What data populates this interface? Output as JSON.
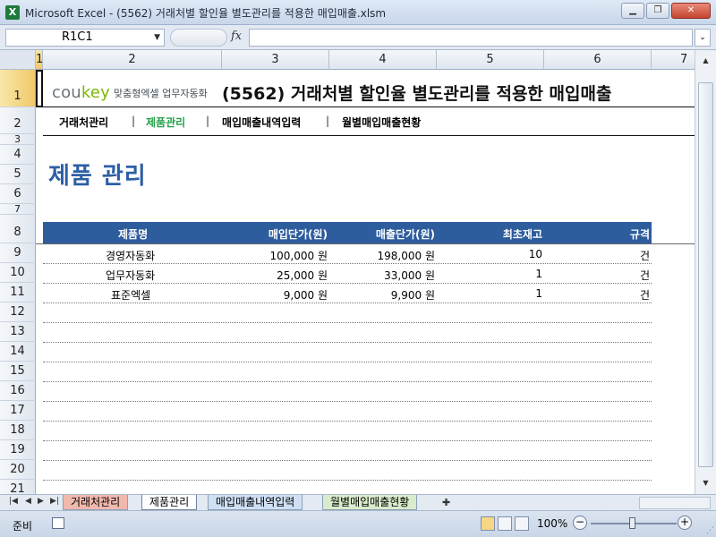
{
  "window": {
    "app_icon": "X",
    "title": "Microsoft Excel - (5562) 거래처별 할인율 별도관리를 적용한 매입매출.xlsm",
    "minimize": "▁",
    "restore": "❐",
    "close": "✕"
  },
  "formula_bar": {
    "name_box": "R1C1",
    "fx": "fx",
    "formula": ""
  },
  "columns": [
    "1",
    "2",
    "3",
    "4",
    "5",
    "6",
    "7"
  ],
  "rows": [
    "1",
    "2",
    "3",
    "4",
    "5",
    "6",
    "7",
    "8",
    "9",
    "10",
    "11",
    "12",
    "13",
    "14",
    "15",
    "16",
    "17",
    "18",
    "19",
    "20",
    "21"
  ],
  "sheet": {
    "logo_brand": "cou",
    "logo_brand_accent": "key",
    "logo_tagline": "맞춤형엑셀 업무자동화",
    "doc_title": "(5562) 거래처별 할인율 별도관리를 적용한 매입매출",
    "nav": {
      "item1": "거래처관리",
      "item2": "제품관리",
      "item3": "매입매출내역입력",
      "item4": "월별매입매출현황",
      "separator": "|"
    },
    "section_title": "제품 관리",
    "table": {
      "headers": [
        "제품명",
        "매입단가(원)",
        "매출단가(원)",
        "최초재고",
        "규격"
      ],
      "rows": [
        {
          "name": "경영자동화",
          "buy": "100,000 원",
          "sell": "198,000 원",
          "stock": "10",
          "unit": "건"
        },
        {
          "name": "업무자동화",
          "buy": "25,000 원",
          "sell": "33,000 원",
          "stock": "1",
          "unit": "건"
        },
        {
          "name": "표준엑셀",
          "buy": "9,000 원",
          "sell": "9,900 원",
          "stock": "1",
          "unit": "건"
        }
      ]
    }
  },
  "tabs": [
    "거래처관리",
    "제품관리",
    "매입매출내역입력",
    "월별매입매출현황"
  ],
  "status": {
    "ready": "준비",
    "zoom": "100%"
  },
  "colors": {
    "accent_blue": "#2e5d9e",
    "title_blue": "#2d5fa5",
    "nav_active_green": "#26a04a",
    "logo_green": "#7ab800"
  }
}
